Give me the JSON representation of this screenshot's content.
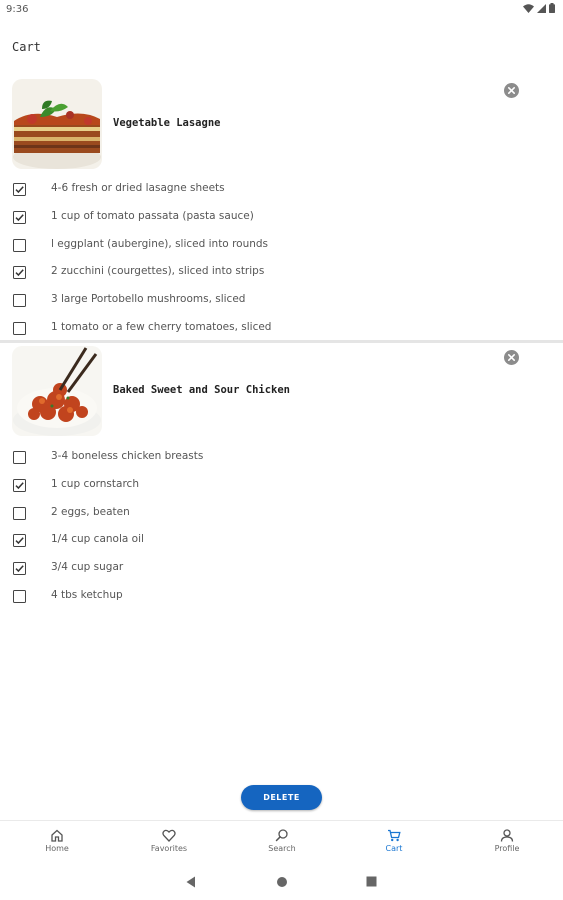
{
  "status": {
    "time": "9:36"
  },
  "page": {
    "title": "Cart"
  },
  "recipes": [
    {
      "title": "Vegetable Lasagne",
      "ingredients": [
        {
          "text": "4-6 fresh or dried lasagne sheets",
          "checked": true
        },
        {
          "text": "1 cup of tomato passata (pasta sauce)",
          "checked": true
        },
        {
          "text": "l eggplant (aubergine), sliced into rounds",
          "checked": false
        },
        {
          "text": "2 zucchini (courgettes), sliced into strips",
          "checked": true
        },
        {
          "text": "3 large Portobello mushrooms, sliced",
          "checked": false
        },
        {
          "text": "1 tomato or a few cherry tomatoes, sliced",
          "checked": false
        }
      ]
    },
    {
      "title": "Baked Sweet and Sour Chicken",
      "ingredients": [
        {
          "text": "3-4 boneless chicken breasts",
          "checked": false
        },
        {
          "text": "1 cup cornstarch",
          "checked": true
        },
        {
          "text": "2 eggs, beaten",
          "checked": false
        },
        {
          "text": "1/4 cup canola oil",
          "checked": true
        },
        {
          "text": "3/4 cup sugar",
          "checked": true
        },
        {
          "text": "4 tbs ketchup",
          "checked": false
        }
      ]
    }
  ],
  "actions": {
    "delete_label": "DELETE"
  },
  "nav": {
    "items": [
      {
        "label": "Home",
        "icon": "home-icon",
        "active": false
      },
      {
        "label": "Favorites",
        "icon": "heart-icon",
        "active": false
      },
      {
        "label": "Search",
        "icon": "search-icon",
        "active": false
      },
      {
        "label": "Cart",
        "icon": "cart-icon",
        "active": true
      },
      {
        "label": "Profile",
        "icon": "person-icon",
        "active": false
      }
    ]
  },
  "colors": {
    "accent": "#1565c0",
    "active_nav": "#1976d2"
  }
}
